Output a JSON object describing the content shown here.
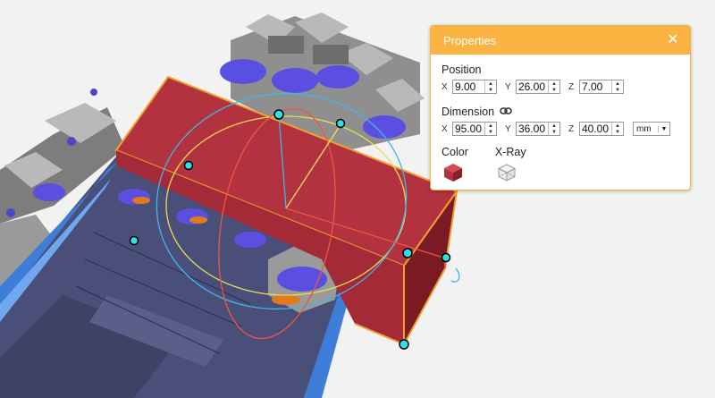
{
  "panel": {
    "title": "Properties",
    "position_label": "Position",
    "position": {
      "x_label": "X",
      "x": "9.00",
      "y_label": "Y",
      "y": "26.00",
      "z_label": "Z",
      "z": "7.00"
    },
    "dimension_label": "Dimension",
    "dimension": {
      "x_label": "X",
      "x": "95.00",
      "y_label": "Y",
      "y": "36.00",
      "z_label": "Z",
      "z": "40.00"
    },
    "unit": "mm",
    "color_label": "Color",
    "xray_label": "X-Ray",
    "color_value": "#b3323f"
  },
  "icons": {
    "close": "close-icon",
    "link": "link-icon",
    "color_cube": "color-cube-icon",
    "xray_cube": "xray-cube-icon",
    "spin_up": "spin-up-icon",
    "spin_down": "spin-down-icon",
    "select_caret": "chevron-down-icon"
  },
  "accent_color": "#fbb441"
}
